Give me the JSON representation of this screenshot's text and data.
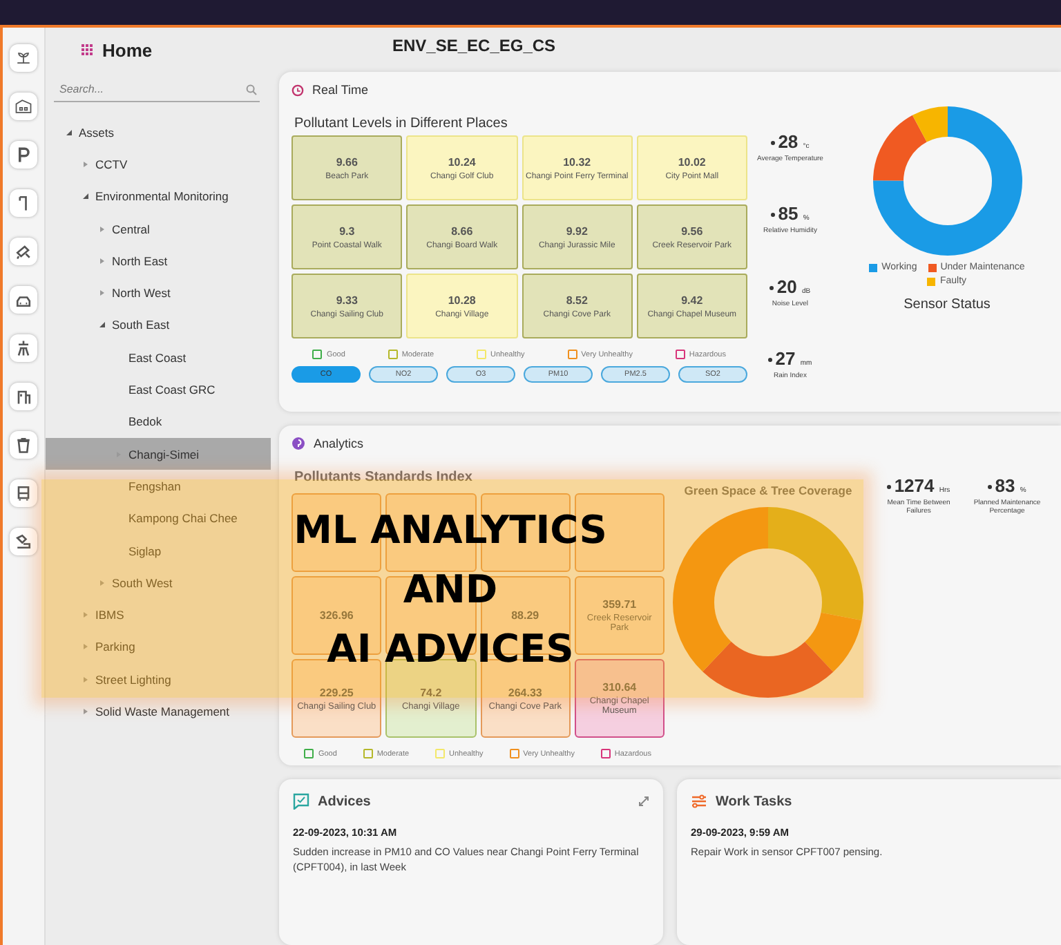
{
  "header": {
    "title": "Home",
    "page_code": "ENV_SE_EC_EG_CS"
  },
  "search": {
    "placeholder": "Search..."
  },
  "tree": [
    {
      "label": "Assets",
      "kind": "branch",
      "expanded": true,
      "selected": false,
      "children": [
        {
          "label": "CCTV",
          "kind": "branch",
          "expanded": false,
          "selected": false
        },
        {
          "label": "Environmental Monitoring",
          "kind": "branch",
          "expanded": true,
          "selected": false,
          "children": [
            {
              "label": "Central",
              "kind": "branch",
              "expanded": false,
              "selected": false
            },
            {
              "label": "North East",
              "kind": "branch",
              "expanded": false,
              "selected": false
            },
            {
              "label": "North West",
              "kind": "branch",
              "expanded": false,
              "selected": false
            },
            {
              "label": "South East",
              "kind": "branch",
              "expanded": true,
              "selected": false,
              "children": [
                {
                  "label": "East Coast",
                  "kind": "leaf",
                  "selected": false
                },
                {
                  "label": "East Coast GRC",
                  "kind": "leaf",
                  "selected": false
                },
                {
                  "label": "Bedok",
                  "kind": "leaf",
                  "selected": false
                },
                {
                  "label": "Changi-Simei",
                  "kind": "branch",
                  "expanded": false,
                  "selected": true
                },
                {
                  "label": "Fengshan",
                  "kind": "leaf",
                  "selected": false
                },
                {
                  "label": "Kampong Chai Chee",
                  "kind": "leaf",
                  "selected": false
                },
                {
                  "label": "Siglap",
                  "kind": "leaf",
                  "selected": false
                }
              ]
            },
            {
              "label": "South West",
              "kind": "branch",
              "expanded": false,
              "selected": false
            }
          ]
        },
        {
          "label": "IBMS",
          "kind": "branch",
          "expanded": false,
          "selected": false
        },
        {
          "label": "Parking",
          "kind": "branch",
          "expanded": false,
          "selected": false
        },
        {
          "label": "Street Lighting",
          "kind": "branch",
          "expanded": false,
          "selected": false
        },
        {
          "label": "Solid Waste Management",
          "kind": "branch",
          "expanded": false,
          "selected": false
        }
      ]
    }
  ],
  "real_time": {
    "title": "Real Time",
    "grid_title": "Pollutant Levels in Different Places",
    "tiles": [
      {
        "value": "9.66",
        "place": "Beach Park",
        "kind": "moderate"
      },
      {
        "value": "10.24",
        "place": "Changi Golf Club",
        "kind": "unhealthy"
      },
      {
        "value": "10.32",
        "place": "Changi Point Ferry Terminal",
        "kind": "unhealthy"
      },
      {
        "value": "10.02",
        "place": "City Point Mall",
        "kind": "unhealthy"
      },
      {
        "value": "9.3",
        "place": "Point Coastal Walk",
        "kind": "moderate"
      },
      {
        "value": "8.66",
        "place": "Changi Board Walk",
        "kind": "moderate"
      },
      {
        "value": "9.92",
        "place": "Changi Jurassic Mile",
        "kind": "moderate"
      },
      {
        "value": "9.56",
        "place": "Creek Reservoir Park",
        "kind": "moderate"
      },
      {
        "value": "9.33",
        "place": "Changi Sailing Club",
        "kind": "moderate"
      },
      {
        "value": "10.28",
        "place": "Changi Village",
        "kind": "unhealthy"
      },
      {
        "value": "8.52",
        "place": "Changi Cove Park",
        "kind": "moderate"
      },
      {
        "value": "9.42",
        "place": "Changi Chapel Museum",
        "kind": "moderate"
      }
    ],
    "legend": [
      {
        "label": "Good",
        "color": "#3fae49"
      },
      {
        "label": "Moderate",
        "color": "#b5b82a"
      },
      {
        "label": "Unhealthy",
        "color": "#f3e86a"
      },
      {
        "label": "Very Unhealthy",
        "color": "#f0901e"
      },
      {
        "label": "Hazardous",
        "color": "#d8357a"
      }
    ],
    "pollutants": [
      {
        "label": "CO",
        "selected": true
      },
      {
        "label": "NO2",
        "selected": false
      },
      {
        "label": "O3",
        "selected": false
      },
      {
        "label": "PM10",
        "selected": false
      },
      {
        "label": "PM2.5",
        "selected": false
      },
      {
        "label": "SO2",
        "selected": false
      }
    ],
    "stats": [
      {
        "value": "28",
        "unit": "°c",
        "label": "Average Temperature"
      },
      {
        "value": "85",
        "unit": "%",
        "label": "Relative Humidity"
      },
      {
        "value": "20",
        "unit": "dB",
        "label": "Noise Level"
      },
      {
        "value": "27",
        "unit": "mm",
        "label": "Rain Index"
      }
    ],
    "sensor_legend": [
      {
        "label": "Working",
        "color": "#1a9be6"
      },
      {
        "label": "Under Maintenance",
        "color": "#f05a22"
      },
      {
        "label": "Faulty",
        "color": "#f7b500"
      }
    ],
    "sensor_title": "Sensor Status"
  },
  "analytics": {
    "title": "Analytics",
    "grid_title": "Pollutants Standards Index",
    "chart_title": "Green Space & Tree Coverage",
    "tiles": [
      {
        "kind": "very_unhealthy"
      },
      {
        "kind": "very_unhealthy"
      },
      {
        "kind": "very_unhealthy"
      },
      {
        "kind": "very_unhealthy"
      },
      {
        "value": "326.96",
        "kind": "very_unhealthy"
      },
      {
        "kind": "very_unhealthy"
      },
      {
        "value": "88.29",
        "kind": "very_unhealthy"
      },
      {
        "value": "359.71",
        "place": "Creek Reservoir Park",
        "kind": "very_unhealthy"
      },
      {
        "value": "229.25",
        "place": "Changi Sailing Club",
        "kind": "very_unhealthy"
      },
      {
        "value": "74.2",
        "place": "Changi Village",
        "kind": "moderate"
      },
      {
        "value": "264.33",
        "place": "Changi Cove Park",
        "kind": "very_unhealthy"
      },
      {
        "value": "310.64",
        "place": "Changi Chapel Museum",
        "kind": "hazardous"
      }
    ],
    "legend": [
      {
        "label": "Good",
        "color": "#3fae49"
      },
      {
        "label": "Moderate",
        "color": "#b5b82a"
      },
      {
        "label": "Unhealthy",
        "color": "#f3e86a"
      },
      {
        "label": "Very Unhealthy",
        "color": "#f0901e"
      },
      {
        "label": "Hazardous",
        "color": "#d8357a"
      }
    ],
    "stats": [
      {
        "value": "1274",
        "unit": "Hrs",
        "label": "Mean Time Between Failures"
      },
      {
        "value": "83",
        "unit": "%",
        "label": "Planned Maintenance Percentage"
      }
    ]
  },
  "advices": {
    "title": "Advices",
    "date": "22-09-2023, 10:31 AM",
    "text": "Sudden increase in PM10 and CO Values near Changi Point Ferry Terminal (CPFT004), in last Week"
  },
  "work_tasks": {
    "title": "Work Tasks",
    "date": "29-09-2023, 9:59 AM",
    "text": "Repair Work in sensor CPFT007 pensing."
  },
  "banner": {
    "lines": [
      "ML ANALYTICS",
      "AND",
      "AI ADVICES"
    ]
  }
}
